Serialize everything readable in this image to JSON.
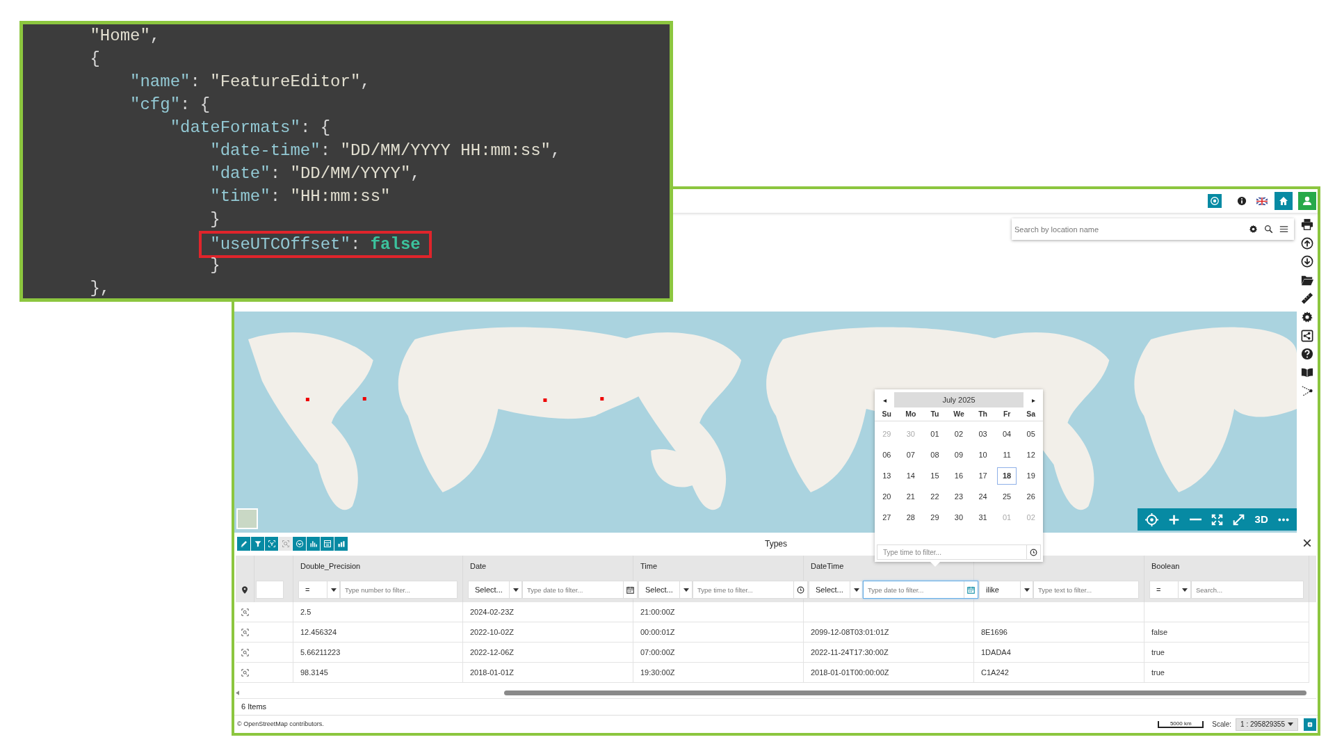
{
  "code_panel": {
    "lines": [
      {
        "highlighted": false,
        "tokens": [
          {
            "kind": "str",
            "text": "      \"Home\""
          },
          {
            "kind": "punct",
            "text": ","
          }
        ]
      },
      {
        "highlighted": false,
        "tokens": [
          {
            "kind": "punct",
            "text": "      {"
          }
        ]
      },
      {
        "highlighted": false,
        "tokens": [
          {
            "kind": "key",
            "text": "          \"name\""
          },
          {
            "kind": "punct",
            "text": ": "
          },
          {
            "kind": "str",
            "text": "\"FeatureEditor\""
          },
          {
            "kind": "punct",
            "text": ","
          }
        ]
      },
      {
        "highlighted": false,
        "tokens": [
          {
            "kind": "key",
            "text": "          \"cfg\""
          },
          {
            "kind": "punct",
            "text": ": {"
          }
        ]
      },
      {
        "highlighted": false,
        "tokens": [
          {
            "kind": "key",
            "text": "              \"dateFormats\""
          },
          {
            "kind": "punct",
            "text": ": {"
          }
        ]
      },
      {
        "highlighted": false,
        "tokens": [
          {
            "kind": "key",
            "text": "                  \"date-time\""
          },
          {
            "kind": "punct",
            "text": ": "
          },
          {
            "kind": "str",
            "text": "\"DD/MM/YYYY HH:mm:ss\""
          },
          {
            "kind": "punct",
            "text": ","
          }
        ]
      },
      {
        "highlighted": false,
        "tokens": [
          {
            "kind": "key",
            "text": "                  \"date\""
          },
          {
            "kind": "punct",
            "text": ": "
          },
          {
            "kind": "str",
            "text": "\"DD/MM/YYYY\""
          },
          {
            "kind": "punct",
            "text": ","
          }
        ]
      },
      {
        "highlighted": false,
        "tokens": [
          {
            "kind": "key",
            "text": "                  \"time\""
          },
          {
            "kind": "punct",
            "text": ": "
          },
          {
            "kind": "str",
            "text": "\"HH:mm:ss\""
          }
        ]
      },
      {
        "highlighted": false,
        "tokens": [
          {
            "kind": "punct",
            "text": "                  }"
          }
        ]
      },
      {
        "highlighted": true,
        "tokens": [
          {
            "kind": "key",
            "text": "                  \"useUTCOffset\""
          },
          {
            "kind": "punct",
            "text": ": "
          },
          {
            "kind": "bool",
            "text": "false"
          }
        ]
      },
      {
        "highlighted": false,
        "tokens": [
          {
            "kind": "punct",
            "text": "                  }"
          }
        ]
      },
      {
        "highlighted": false,
        "tokens": [
          {
            "kind": "punct",
            "text": "      },"
          }
        ]
      }
    ]
  },
  "app": {
    "search": {
      "placeholder": "Search by location name"
    },
    "map_controls": {
      "label_3d": "3D"
    },
    "calendar": {
      "month": "July 2025",
      "prev": "◂",
      "next": "▸",
      "weekdays": [
        "Su",
        "Mo",
        "Tu",
        "We",
        "Th",
        "Fr",
        "Sa"
      ],
      "weeks": [
        [
          {
            "day": "29",
            "outside": true,
            "selected": false
          },
          {
            "day": "30",
            "outside": true,
            "selected": false
          },
          {
            "day": "01",
            "outside": false,
            "selected": false
          },
          {
            "day": "02",
            "outside": false,
            "selected": false
          },
          {
            "day": "03",
            "outside": false,
            "selected": false
          },
          {
            "day": "04",
            "outside": false,
            "selected": false
          },
          {
            "day": "05",
            "outside": false,
            "selected": false
          }
        ],
        [
          {
            "day": "06",
            "outside": false,
            "selected": false
          },
          {
            "day": "07",
            "outside": false,
            "selected": false
          },
          {
            "day": "08",
            "outside": false,
            "selected": false
          },
          {
            "day": "09",
            "outside": false,
            "selected": false
          },
          {
            "day": "10",
            "outside": false,
            "selected": false
          },
          {
            "day": "11",
            "outside": false,
            "selected": false
          },
          {
            "day": "12",
            "outside": false,
            "selected": false
          }
        ],
        [
          {
            "day": "13",
            "outside": false,
            "selected": false
          },
          {
            "day": "14",
            "outside": false,
            "selected": false
          },
          {
            "day": "15",
            "outside": false,
            "selected": false
          },
          {
            "day": "16",
            "outside": false,
            "selected": false
          },
          {
            "day": "17",
            "outside": false,
            "selected": false
          },
          {
            "day": "18",
            "outside": false,
            "selected": true
          },
          {
            "day": "19",
            "outside": false,
            "selected": false
          }
        ],
        [
          {
            "day": "20",
            "outside": false,
            "selected": false
          },
          {
            "day": "21",
            "outside": false,
            "selected": false
          },
          {
            "day": "22",
            "outside": false,
            "selected": false
          },
          {
            "day": "23",
            "outside": false,
            "selected": false
          },
          {
            "day": "24",
            "outside": false,
            "selected": false
          },
          {
            "day": "25",
            "outside": false,
            "selected": false
          },
          {
            "day": "26",
            "outside": false,
            "selected": false
          }
        ],
        [
          {
            "day": "27",
            "outside": false,
            "selected": false
          },
          {
            "day": "28",
            "outside": false,
            "selected": false
          },
          {
            "day": "29",
            "outside": false,
            "selected": false
          },
          {
            "day": "30",
            "outside": false,
            "selected": false
          },
          {
            "day": "31",
            "outside": false,
            "selected": false
          },
          {
            "day": "01",
            "outside": true,
            "selected": false
          },
          {
            "day": "02",
            "outside": true,
            "selected": false
          }
        ]
      ],
      "time_field": {
        "placeholder": "Type time to filter..."
      }
    },
    "grid": {
      "title": "Types",
      "close": "×",
      "toolbar": [
        {
          "kind": "edit",
          "disabled": false
        },
        {
          "kind": "filter",
          "disabled": false
        },
        {
          "kind": "zoom-selection",
          "disabled": false
        },
        {
          "kind": "zoom",
          "disabled": true
        },
        {
          "kind": "sync",
          "disabled": false
        },
        {
          "kind": "chart",
          "disabled": false
        },
        {
          "kind": "settings",
          "disabled": false
        },
        {
          "kind": "widget",
          "disabled": false
        }
      ],
      "columns": [
        {
          "kind": "pin"
        },
        {
          "kind": "blank"
        },
        {
          "kind": "number",
          "header": "Double_Precision",
          "operator": "=",
          "placeholder": "Type number to filter...",
          "focused": false
        },
        {
          "kind": "date",
          "header": "Date",
          "operator": "Select...",
          "placeholder": "Type date to filter...",
          "focused": false
        },
        {
          "kind": "time",
          "header": "Time",
          "operator": "Select...",
          "placeholder": "Type time to filter...",
          "focused": false
        },
        {
          "kind": "date",
          "header": "DateTime",
          "operator": "Select...",
          "placeholder": "Type date to filter...",
          "focused": true
        },
        {
          "kind": "text",
          "operator": "ilike",
          "placeholder": "Type text to filter...",
          "focused": false
        },
        {
          "kind": "text",
          "header": "Boolean",
          "operator": "=",
          "placeholder": "Search...",
          "focused": false
        }
      ],
      "rows": [
        {
          "cells": [
            null,
            null,
            "2.5",
            "2024-02-23Z",
            "21:00:00Z",
            null,
            null,
            null
          ]
        },
        {
          "cells": [
            null,
            null,
            "12.456324",
            "2022-10-02Z",
            "00:00:01Z",
            "2099-12-08T03:01:01Z",
            "8E1696",
            "false"
          ]
        },
        {
          "cells": [
            null,
            null,
            "5.66211223",
            "2022-12-06Z",
            "07:00:00Z",
            "2022-11-24T17:30:00Z",
            "1DADA4",
            "true"
          ]
        },
        {
          "cells": [
            null,
            null,
            "98.3145",
            "2018-01-01Z",
            "19:30:00Z",
            "2018-01-01T00:00:00Z",
            "C1A242",
            "true"
          ]
        }
      ],
      "footer": "6 Items"
    },
    "bottom_bar": {
      "attribution": "© OpenStreetMap contributors.",
      "scale_bar": "5000 km",
      "scale_label": "Scale:",
      "scale_value": "1 : 295829355"
    }
  }
}
